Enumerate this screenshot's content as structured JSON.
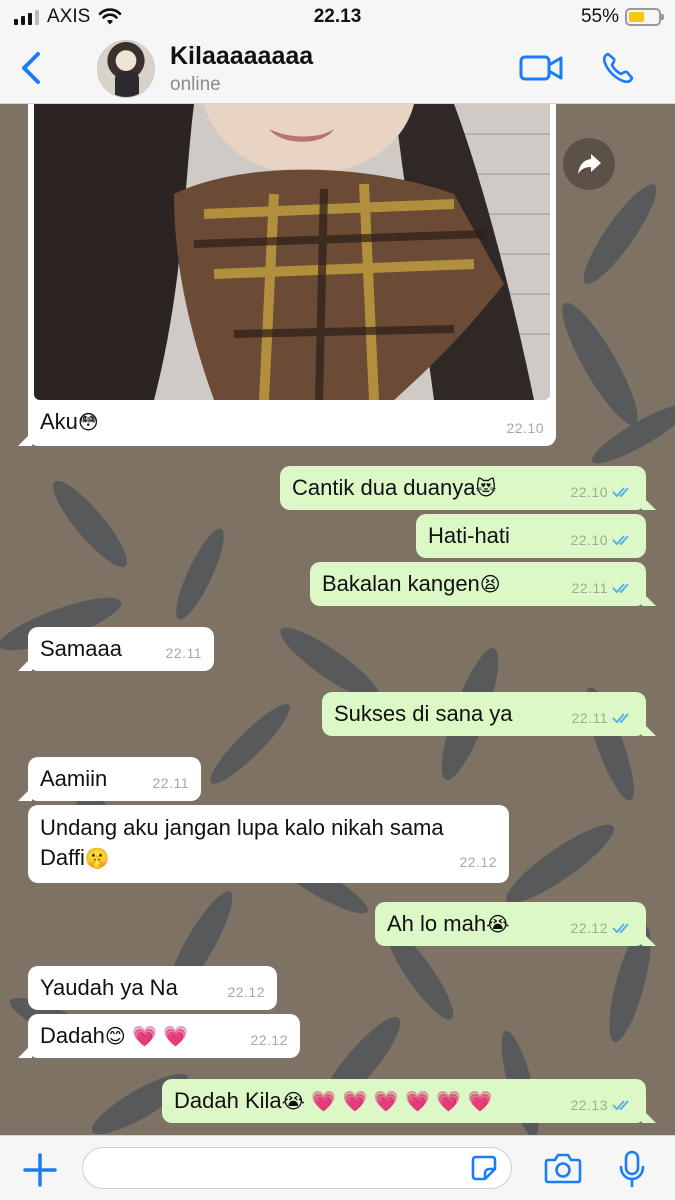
{
  "status_bar": {
    "carrier": "AXIS",
    "time": "22.13",
    "battery": "55%",
    "battery_level": 0.55,
    "battery_color": "#f5c70f"
  },
  "header": {
    "contact_name": "Kilaaaaaaaa",
    "status": "online",
    "accent_color": "#1a7cf6",
    "icons": [
      "back-chevron-icon",
      "video-call-icon",
      "phone-icon"
    ]
  },
  "photo_message": {
    "caption": "Aku",
    "caption_emoji": "😳",
    "time": "22.10"
  },
  "messages": [
    {
      "dir": "out",
      "text": "Cantik dua duanya",
      "emoji": "😻",
      "time": "22.10"
    },
    {
      "dir": "out",
      "text": "Hati-hati",
      "emoji": "",
      "time": "22.10"
    },
    {
      "dir": "out",
      "text": "Bakalan kangen",
      "emoji": "😫",
      "time": "22.11"
    },
    {
      "dir": "in",
      "text": "Samaaa",
      "emoji": "",
      "time": "22.11"
    },
    {
      "dir": "out",
      "text": "Sukses di sana ya",
      "emoji": "",
      "time": "22.11"
    },
    {
      "dir": "in",
      "text": "Aamiin",
      "emoji": "",
      "time": "22.11"
    },
    {
      "dir": "in",
      "text": "Undang aku jangan lupa kalo nikah sama",
      "text2": "Daffi",
      "emoji": "🤫",
      "time": "22.12"
    },
    {
      "dir": "out",
      "text": "Ah lo mah",
      "emoji": "😭",
      "time": "22.12"
    },
    {
      "dir": "in",
      "text": "Yaudah ya Na",
      "emoji": "",
      "time": "22.12"
    },
    {
      "dir": "in",
      "text": "Dadah",
      "emoji": "😊 💗 💗",
      "time": "22.12"
    },
    {
      "dir": "out",
      "text": "Dadah Kila",
      "emoji": "😭 💗 💗 💗 💗 💗 💗",
      "time": "22.13"
    }
  ],
  "composer": {
    "placeholder": "",
    "icons": [
      "plus-icon",
      "sticker-icon",
      "camera-icon",
      "microphone-icon"
    ]
  },
  "colors": {
    "incoming_bubble": "#ffffff",
    "outgoing_bubble": "#dcf8c6",
    "read_tick": "#4fb0e8"
  }
}
